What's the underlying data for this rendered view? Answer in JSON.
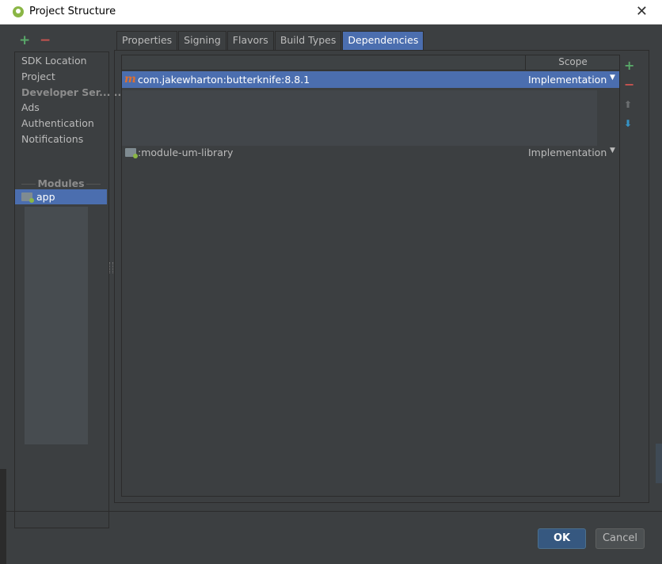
{
  "window": {
    "title": "Project Structure",
    "close_glyph": "✕"
  },
  "left_toolbar": {
    "add_glyph": "+",
    "remove_glyph": "−"
  },
  "left_nav": {
    "items": [
      "SDK Location",
      "Project",
      "Developer Ser... ...",
      "Ads",
      "Authentication",
      "Notifications"
    ],
    "modules_label": "Modules",
    "selected_module": "app"
  },
  "tabs": [
    "Properties",
    "Signing",
    "Flavors",
    "Build Types",
    "Dependencies"
  ],
  "active_tab": "Dependencies",
  "table": {
    "scope_header": "Scope",
    "rows": [
      {
        "name": "com.jakewharton:butterknife:8.8.1",
        "scope": "Implementation",
        "icon": "maven-m-icon",
        "selected": true
      },
      {
        "name": ":module-um-library",
        "scope": "Implementation",
        "icon": "module-folder-icon",
        "selected": false
      }
    ]
  },
  "right_toolbar": {
    "add_glyph": "+",
    "remove_glyph": "−",
    "up_glyph": "⬆",
    "down_glyph": "⬇"
  },
  "buttons": {
    "ok": "OK",
    "cancel": "Cancel"
  },
  "colors": {
    "selection": "#4b6eaf",
    "add": "#59a869",
    "remove": "#c75450",
    "move_down": "#3592c4",
    "maven": "#e0702f",
    "background": "#3c3f41"
  }
}
